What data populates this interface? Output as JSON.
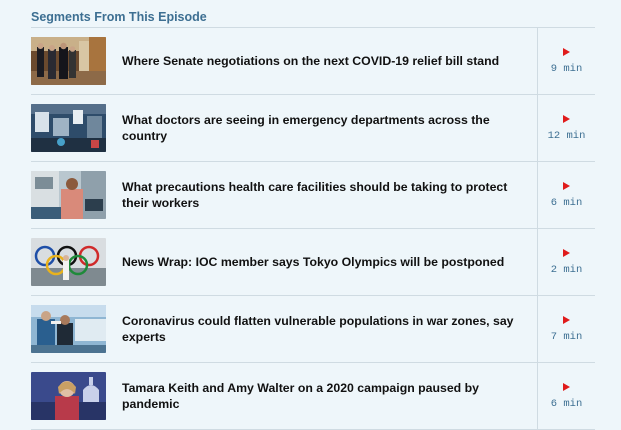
{
  "section": {
    "title": "Segments From This Episode"
  },
  "segments": [
    {
      "title": "Where Senate negotiations on the next COVID-19 relief bill stand",
      "duration": "9 min",
      "thumb_icon": "senate-hallway-photo"
    },
    {
      "title": "What doctors are seeing in emergency departments across the country",
      "duration": "12 min",
      "thumb_icon": "hospital-equipment-photo"
    },
    {
      "title": "What precautions health care facilities should be taking to protect their workers",
      "duration": "6 min",
      "thumb_icon": "health-worker-photo"
    },
    {
      "title": "News Wrap: IOC member says Tokyo Olympics will be postponed",
      "duration": "2 min",
      "thumb_icon": "olympic-rings-photo"
    },
    {
      "title": "Coronavirus could flatten vulnerable populations in war zones, say experts",
      "duration": "7 min",
      "thumb_icon": "temperature-check-photo"
    },
    {
      "title": "Tamara Keith and Amy Walter on a 2020 campaign paused by pandemic",
      "duration": "6 min",
      "thumb_icon": "reporter-capitol-photo"
    }
  ],
  "colors": {
    "accent": "#3d6f92",
    "play": "#e01b1b",
    "background": "#eef6fa"
  }
}
